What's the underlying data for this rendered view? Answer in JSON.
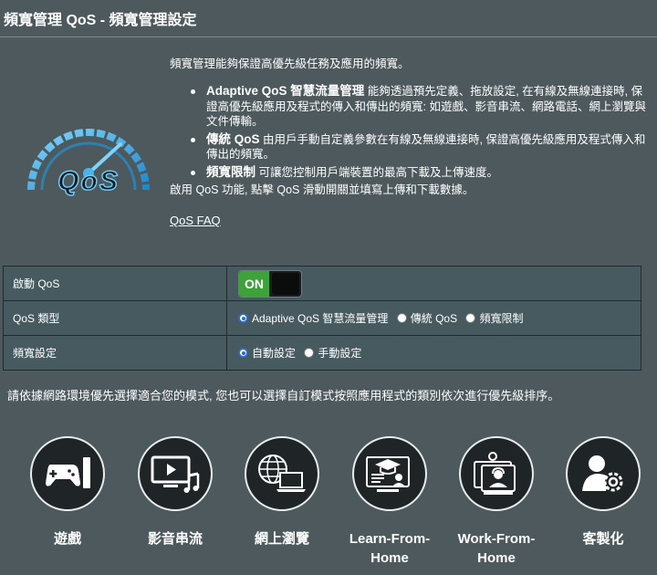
{
  "header": {
    "title": "頻寬管理 QoS - 頻寬管理設定"
  },
  "intro": {
    "lead": "頻寬管理能夠保證高優先級任務及應用的頻寬。",
    "bullets": [
      {
        "term": "Adaptive QoS 智慧流量管理",
        "text": " 能夠透過預先定義、拖放設定, 在有線及無線連接時, 保證高優先級應用及程式的傳入和傳出的頻寬: 如遊戲、影音串流、網路電話、網上瀏覽與文件傳輸。"
      },
      {
        "term": "傳統 QoS",
        "text": " 由用戶手動自定義參數在有線及無線連接時, 保證高優先級應用及程式傳入和傳出的頻寬。"
      },
      {
        "term": "頻寬限制",
        "text": " 可讓您控制用戶端裝置的最高下載及上傳速度。"
      }
    ],
    "enable_text": "啟用 QoS 功能, 點擊 QoS 滑動開關並填寫上傳和下載數據。",
    "faq_link": "QoS FAQ"
  },
  "logo": {
    "text": "QoS"
  },
  "settings": {
    "enable": {
      "label": "啟動 QoS",
      "toggle": "ON"
    },
    "type": {
      "label": "QoS 類型",
      "options": [
        "Adaptive QoS 智慧流量管理",
        "傳統 QoS",
        "頻寬限制"
      ],
      "selected": 0
    },
    "bandwidth": {
      "label": "頻寬設定",
      "options": [
        "自動設定",
        "手動設定"
      ],
      "selected": 0
    }
  },
  "mode_hint": "請依據網路環境優先選擇適合您的模式, 您也可以選擇自訂模式按照應用程式的類別依次進行優先級排序。",
  "modes": [
    {
      "label": "遊戲",
      "icon": "gamepad-icon"
    },
    {
      "label": "影音串流",
      "icon": "media-streaming-icon"
    },
    {
      "label": "網上瀏覽",
      "icon": "web-browsing-icon"
    },
    {
      "label": "Learn-From-Home",
      "line1": "Learn-From-",
      "line2": "Home",
      "icon": "learn-from-home-icon"
    },
    {
      "label": "Work-From-Home",
      "line1": "Work-From-",
      "line2": "Home",
      "icon": "work-from-home-icon"
    },
    {
      "label": "客製化",
      "icon": "customize-icon"
    }
  ],
  "colors": {
    "background": "#4d595d",
    "toggle_on": "#3ea13a",
    "radio": "#2b6cd1",
    "logo_blue": "#4ab3e8"
  }
}
